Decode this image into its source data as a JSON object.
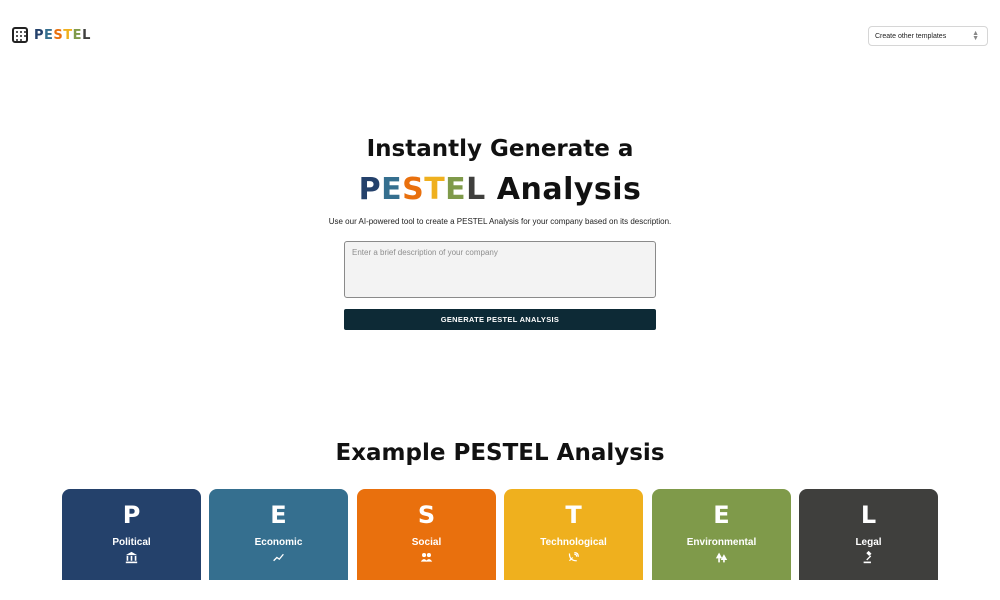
{
  "header": {
    "logo_text": "PESTEL",
    "template_select": {
      "value": "Create other templates"
    }
  },
  "hero": {
    "line1": "Instantly Generate a",
    "line2_suffix": "Analysis",
    "pestel_letters": [
      {
        "char": "P",
        "color": "#24416b"
      },
      {
        "char": "E",
        "color": "#356f8f"
      },
      {
        "char": "S",
        "color": "#e9700d"
      },
      {
        "char": "T",
        "color": "#efb01e"
      },
      {
        "char": "E",
        "color": "#7f9a4a"
      },
      {
        "char": "L",
        "color": "#3f3f3d"
      }
    ],
    "subtitle": "Use our AI-powered tool to create a PESTEL Analysis for your company based on its description."
  },
  "form": {
    "description_placeholder": "Enter a brief description of your company",
    "description_value": "",
    "generate_label": "GENERATE PESTEL ANALYSIS"
  },
  "example": {
    "title": "Example PESTEL Analysis",
    "cards": [
      {
        "letter": "P",
        "name": "Political",
        "icon": "government-building-icon",
        "color": "#24416b"
      },
      {
        "letter": "E",
        "name": "Economic",
        "icon": "trending-line-icon",
        "color": "#356f8f"
      },
      {
        "letter": "S",
        "name": "Social",
        "icon": "people-icon",
        "color": "#e9700d"
      },
      {
        "letter": "T",
        "name": "Technological",
        "icon": "satellite-dish-icon",
        "color": "#efb01e"
      },
      {
        "letter": "E",
        "name": "Environmental",
        "icon": "forest-icon",
        "color": "#7f9a4a"
      },
      {
        "letter": "L",
        "name": "Legal",
        "icon": "gavel-icon",
        "color": "#3f3f3d"
      }
    ]
  }
}
